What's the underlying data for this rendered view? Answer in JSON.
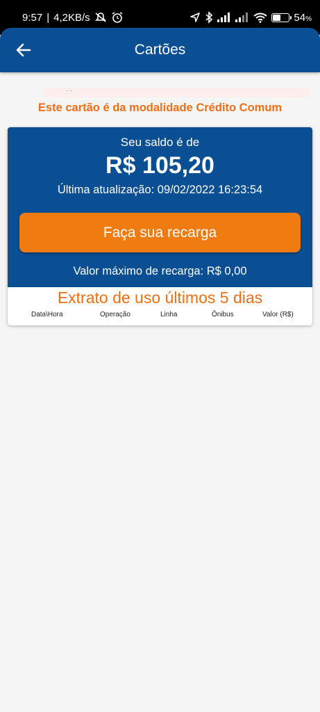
{
  "status_bar": {
    "time": "9:57",
    "network_speed": "4,2KB/s",
    "battery_percent": "54",
    "battery_symbol": "%",
    "battery_level": 0.54,
    "icons": [
      "mute-icon",
      "alarm-icon",
      "location-icon",
      "bluetooth-icon",
      "signal-icon",
      "signal-icon",
      "wifi-icon",
      "battery-icon"
    ]
  },
  "appbar": {
    "title": "Cartões",
    "back_icon": "arrow-left-icon"
  },
  "card_info": {
    "modalidade": "Este cartão é da modalidade Crédito Comum"
  },
  "balance": {
    "label": "Seu saldo é de",
    "value": "R$ 105,20",
    "last_update": "Última atualização: 09/02/2022 16:23:54",
    "recharge_button": "Faça sua recarga",
    "max_recharge": "Valor máximo de recarga: R$ 0,00"
  },
  "statement": {
    "title": "Extrato de uso últimos 5 dias",
    "columns": [
      "Data\\Hora",
      "Operação",
      "Linha",
      "Ônibus",
      "Valor (R$)"
    ]
  },
  "colors": {
    "primary_blue": "#0a4f94",
    "accent_orange": "#f07b10",
    "text_orange": "#ee6f14"
  }
}
